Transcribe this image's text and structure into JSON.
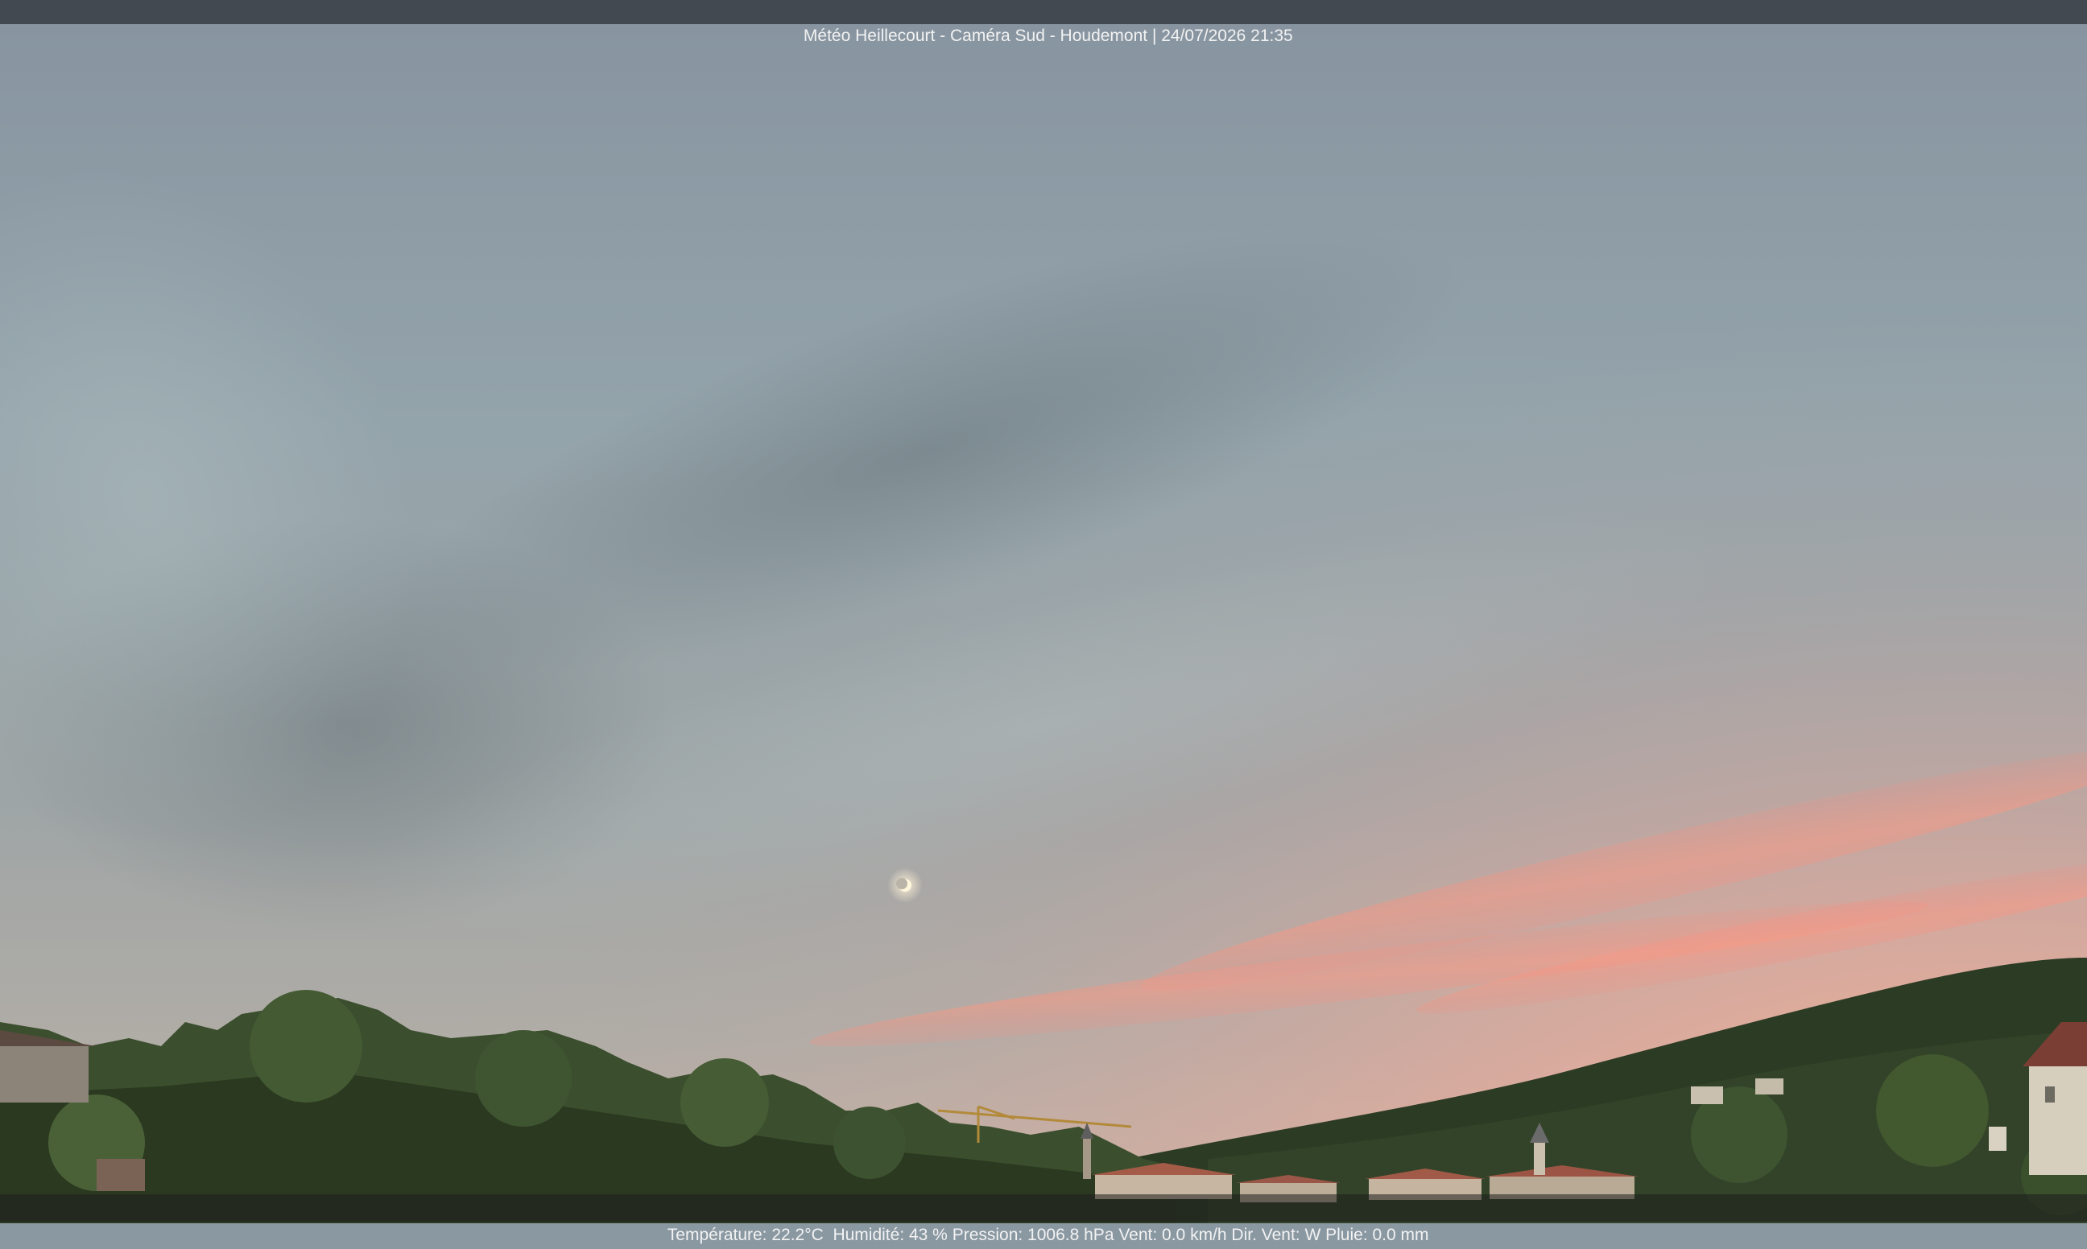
{
  "header": {
    "title": "Météo Heillecourt - Caméra Sud - Houdemont | 24/07/2026 21:35"
  },
  "footer": {
    "weather_line": "Température: 22.2°C  Humidité: 43 % Pression: 1006.8 hPa Vent: 0.0 km/h Dir. Vent: W Pluie: 0.0 mm"
  },
  "scene": {
    "sky_top_color": "#8e9ca6",
    "sky_mid_color": "#9aa6aa",
    "sunset_color": "#f0a48c",
    "hill_color": "#2b3a22",
    "tree_color": "#3e5230",
    "moon_icon": "moon-icon"
  }
}
